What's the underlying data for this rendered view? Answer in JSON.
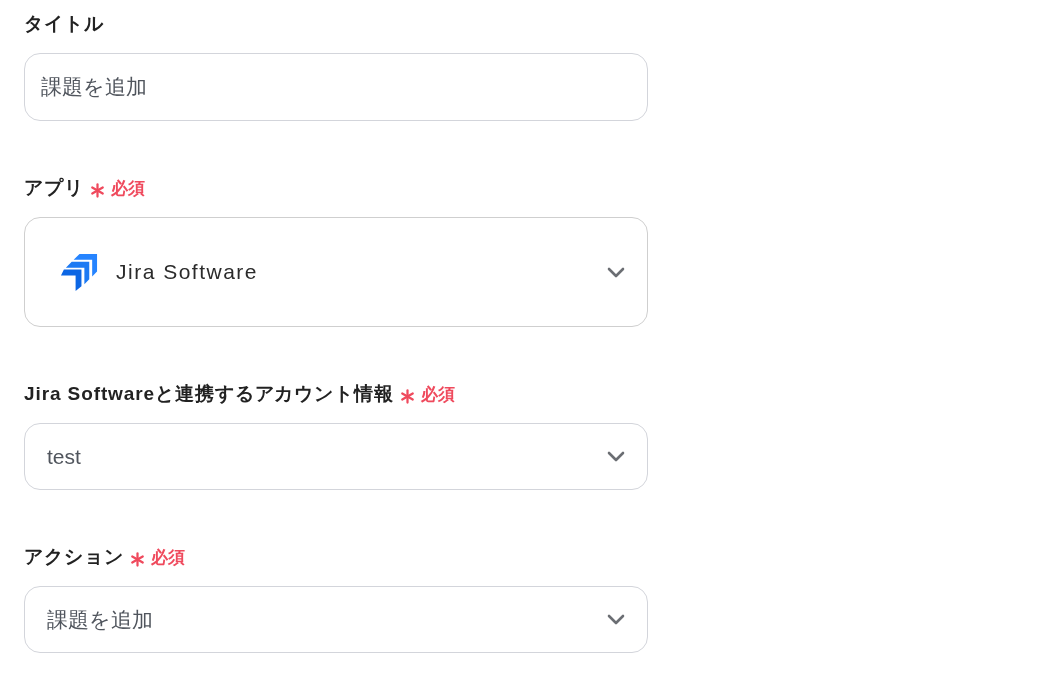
{
  "fields": [
    {
      "label": "タイトル",
      "required": false,
      "kind": "input",
      "value": "課題を追加"
    },
    {
      "label": "アプリ",
      "required": true,
      "required_text": "必須",
      "kind": "app-select",
      "value": "Jira Software"
    },
    {
      "label": "Jira Softwareと連携するアカウント情報",
      "required": true,
      "required_text": "必須",
      "kind": "select",
      "value": "test"
    },
    {
      "label": "アクション",
      "required": true,
      "required_text": "必須",
      "kind": "select",
      "value": "課題を追加"
    }
  ]
}
